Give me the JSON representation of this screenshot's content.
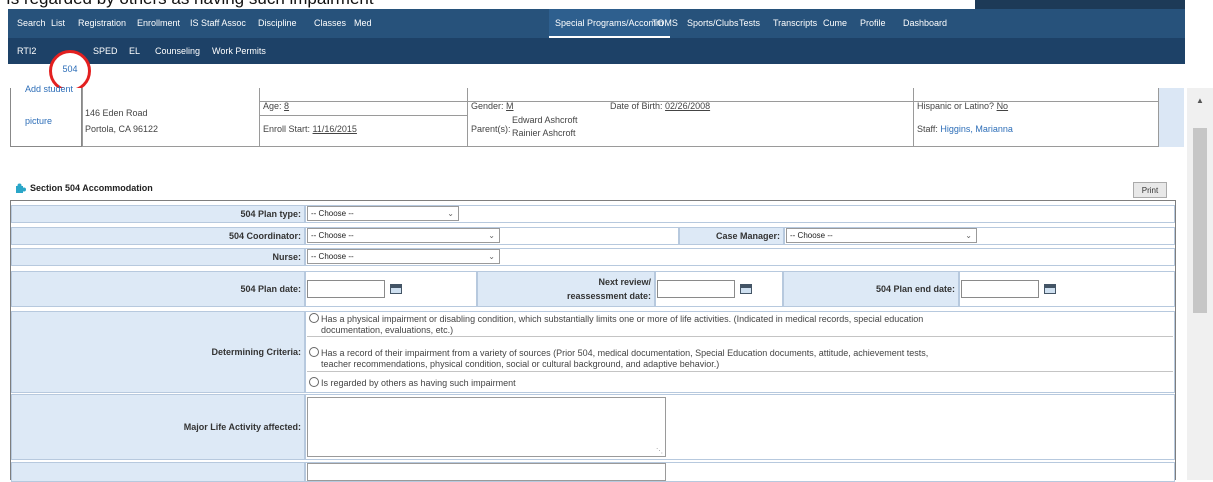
{
  "caption": "Is regarded by others as having such impairment",
  "nav": {
    "tabs": [
      "Search",
      "List",
      "Registration",
      "Enrollment",
      "IS Staff Assoc",
      "Discipline",
      "Classes",
      "Med",
      "Special Programs/Accomm",
      "TOMS",
      "Sports/Clubs",
      "Tests",
      "Transcripts",
      "Cume",
      "Profile",
      "Dashboard"
    ],
    "active_tab": "Special Programs/Accomm",
    "subtabs": [
      "RTI2",
      "504",
      "SPED",
      "EL",
      "Counseling",
      "Work Permits"
    ],
    "active_subtab": "504"
  },
  "student": {
    "photo_label_1": "Add student",
    "photo_label_2": "picture",
    "address_line1": "146 Eden Road",
    "address_line2": "Portola, CA 96122",
    "age_label": "Age:",
    "age": "8",
    "enroll_label": "Enroll Start:",
    "enroll_start": "11/16/2015",
    "gender_label": "Gender:",
    "gender": "M",
    "dob_label": "Date of Birth:",
    "dob": "02/26/2008",
    "parents_label": "Parent(s):",
    "parent1": "Edward Ashcroft",
    "parent2": "Rainier Ashcroft",
    "hispanic_label": "Hispanic or Latino?",
    "hispanic": "No",
    "staff_label": "Staff:",
    "staff": "Higgins, Marianna"
  },
  "section": {
    "title": "Section 504 Accommodation",
    "print_label": "Print"
  },
  "form": {
    "plan_type_label": "504 Plan type:",
    "plan_type_value": "-- Choose --",
    "coordinator_label": "504 Coordinator:",
    "coordinator_value": "-- Choose --",
    "case_manager_label": "Case Manager:",
    "case_manager_value": "-- Choose --",
    "nurse_label": "Nurse:",
    "nurse_value": "-- Choose --",
    "plan_date_label": "504 Plan date:",
    "next_review_label_1": "Next review/",
    "next_review_label_2": "reassessment date:",
    "plan_end_label": "504 Plan end date:",
    "criteria_label": "Determining Criteria:",
    "criteria": [
      {
        "line1": "Has a physical impairment or disabling condition, which substantially limits one or more of life activities. (Indicated in medical records, special education",
        "line2": "documentation, evaluations, etc.)"
      },
      {
        "line1": "Has a record of their impairment from a variety of sources (Prior 504, medical documentation, Special Education documents, attitude, achievement tests,",
        "line2": "teacher recommendations, physical condition, social or cultural background, and adaptive behavior.)"
      },
      {
        "line1": "Is regarded by others as having such impairment",
        "line2": ""
      }
    ],
    "major_life_label": "Major Life Activity affected:"
  }
}
